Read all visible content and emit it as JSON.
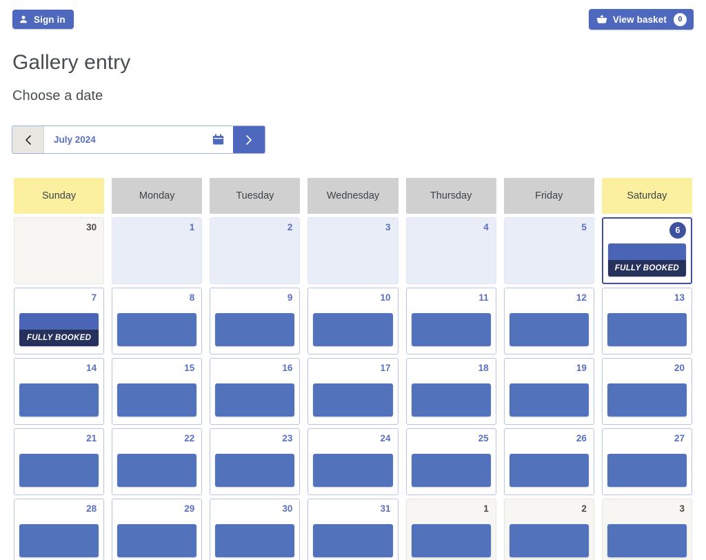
{
  "topbar": {
    "signin_label": "Sign in",
    "signin_icon": "user-icon",
    "basket_label": "View basket",
    "basket_icon": "basket-icon",
    "basket_count": "0"
  },
  "page": {
    "title": "Gallery entry",
    "subtitle": "Choose a date"
  },
  "monthnav": {
    "prev_icon": "chevron-left-icon",
    "next_icon": "chevron-right-icon",
    "calendar_icon": "calendar-icon",
    "month_label": "July 2024"
  },
  "calendar": {
    "daynames": [
      {
        "label": "Sunday",
        "weekend": true
      },
      {
        "label": "Monday",
        "weekend": false
      },
      {
        "label": "Tuesday",
        "weekend": false
      },
      {
        "label": "Wednesday",
        "weekend": false
      },
      {
        "label": "Thursday",
        "weekend": false
      },
      {
        "label": "Friday",
        "weekend": false
      },
      {
        "label": "Saturday",
        "weekend": true
      }
    ],
    "fully_booked_label": "FULLY BOOKED",
    "weeks": [
      [
        {
          "num": "30",
          "state": "other",
          "slot": "none",
          "today": false
        },
        {
          "num": "1",
          "state": "past",
          "slot": "none",
          "today": false
        },
        {
          "num": "2",
          "state": "past",
          "slot": "none",
          "today": false
        },
        {
          "num": "3",
          "state": "past",
          "slot": "none",
          "today": false
        },
        {
          "num": "4",
          "state": "past",
          "slot": "none",
          "today": false
        },
        {
          "num": "5",
          "state": "past",
          "slot": "none",
          "today": false
        },
        {
          "num": "6",
          "state": "current",
          "slot": "booked",
          "today": true
        }
      ],
      [
        {
          "num": "7",
          "state": "current",
          "slot": "booked",
          "today": false
        },
        {
          "num": "8",
          "state": "current",
          "slot": "open",
          "today": false
        },
        {
          "num": "9",
          "state": "current",
          "slot": "open",
          "today": false
        },
        {
          "num": "10",
          "state": "current",
          "slot": "open",
          "today": false
        },
        {
          "num": "11",
          "state": "current",
          "slot": "open",
          "today": false
        },
        {
          "num": "12",
          "state": "current",
          "slot": "open",
          "today": false
        },
        {
          "num": "13",
          "state": "current",
          "slot": "open",
          "today": false
        }
      ],
      [
        {
          "num": "14",
          "state": "current",
          "slot": "open",
          "today": false
        },
        {
          "num": "15",
          "state": "current",
          "slot": "open",
          "today": false
        },
        {
          "num": "16",
          "state": "current",
          "slot": "open",
          "today": false
        },
        {
          "num": "17",
          "state": "current",
          "slot": "open",
          "today": false
        },
        {
          "num": "18",
          "state": "current",
          "slot": "open",
          "today": false
        },
        {
          "num": "19",
          "state": "current",
          "slot": "open",
          "today": false
        },
        {
          "num": "20",
          "state": "current",
          "slot": "open",
          "today": false
        }
      ],
      [
        {
          "num": "21",
          "state": "current",
          "slot": "open",
          "today": false
        },
        {
          "num": "22",
          "state": "current",
          "slot": "open",
          "today": false
        },
        {
          "num": "23",
          "state": "current",
          "slot": "open",
          "today": false
        },
        {
          "num": "24",
          "state": "current",
          "slot": "open",
          "today": false
        },
        {
          "num": "25",
          "state": "current",
          "slot": "open",
          "today": false
        },
        {
          "num": "26",
          "state": "current",
          "slot": "open",
          "today": false
        },
        {
          "num": "27",
          "state": "current",
          "slot": "open",
          "today": false
        }
      ],
      [
        {
          "num": "28",
          "state": "current",
          "slot": "open",
          "today": false
        },
        {
          "num": "29",
          "state": "current",
          "slot": "open",
          "today": false
        },
        {
          "num": "30",
          "state": "current",
          "slot": "open",
          "today": false
        },
        {
          "num": "31",
          "state": "current",
          "slot": "open",
          "today": false
        },
        {
          "num": "1",
          "state": "other",
          "slot": "open",
          "today": false
        },
        {
          "num": "2",
          "state": "other",
          "slot": "open",
          "today": false
        },
        {
          "num": "3",
          "state": "other",
          "slot": "open",
          "today": false
        }
      ]
    ]
  },
  "colors": {
    "accent": "#4e68bd",
    "slot": "#5272bc",
    "booked": "#26325c",
    "weekend_header": "#fbf0a0",
    "weekday_header": "#d0d0d0"
  }
}
